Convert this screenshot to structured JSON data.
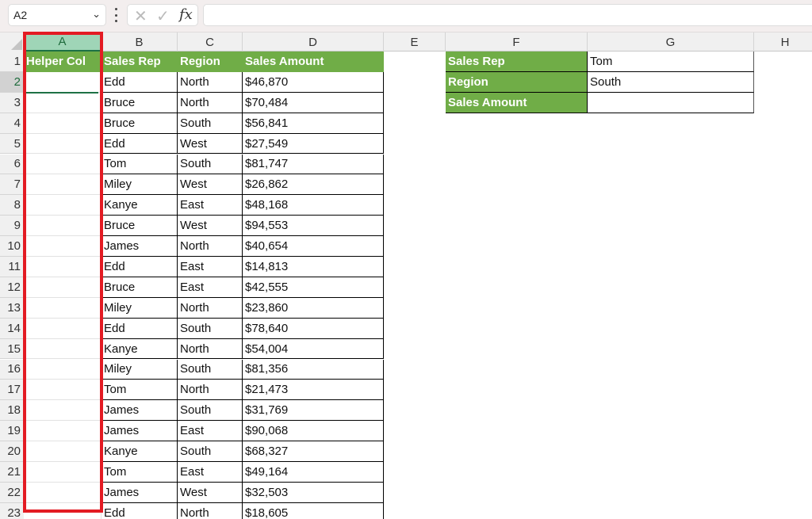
{
  "formula_bar": {
    "name_box": "A2",
    "formula": "",
    "cancel_icon": "close-icon",
    "enter_icon": "check-icon",
    "function_label": "fx"
  },
  "columns": [
    "A",
    "B",
    "C",
    "D",
    "E",
    "F",
    "G",
    "H"
  ],
  "selected_column": "A",
  "rows": [
    "1",
    "2",
    "3",
    "4",
    "5",
    "6",
    "7",
    "8",
    "9",
    "10",
    "11",
    "12",
    "13",
    "14",
    "15",
    "16",
    "17",
    "18",
    "19",
    "20",
    "21",
    "22",
    "23"
  ],
  "selected_row": "2",
  "table": {
    "headers": [
      "Helper Col",
      "Sales Rep",
      "Region",
      "Sales Amount"
    ],
    "data": [
      [
        "",
        "Edd",
        "North",
        "$46,870"
      ],
      [
        "",
        "Bruce",
        "North",
        "$70,484"
      ],
      [
        "",
        "Bruce",
        "South",
        "$56,841"
      ],
      [
        "",
        "Edd",
        "West",
        "$27,549"
      ],
      [
        "",
        "Tom",
        "South",
        "$81,747"
      ],
      [
        "",
        "Miley",
        "West",
        "$26,862"
      ],
      [
        "",
        "Kanye",
        "East",
        "$48,168"
      ],
      [
        "",
        "Bruce",
        "West",
        "$94,553"
      ],
      [
        "",
        "James",
        "North",
        "$40,654"
      ],
      [
        "",
        "Edd",
        "East",
        "$14,813"
      ],
      [
        "",
        "Bruce",
        "East",
        "$42,555"
      ],
      [
        "",
        "Miley",
        "North",
        "$23,860"
      ],
      [
        "",
        "Edd",
        "South",
        "$78,640"
      ],
      [
        "",
        "Kanye",
        "North",
        "$54,004"
      ],
      [
        "",
        "Miley",
        "South",
        "$81,356"
      ],
      [
        "",
        "Tom",
        "North",
        "$21,473"
      ],
      [
        "",
        "James",
        "South",
        "$31,769"
      ],
      [
        "",
        "James",
        "East",
        "$90,068"
      ],
      [
        "",
        "Kanye",
        "South",
        "$68,327"
      ],
      [
        "",
        "Tom",
        "East",
        "$49,164"
      ],
      [
        "",
        "James",
        "West",
        "$32,503"
      ],
      [
        "",
        "Edd",
        "North",
        "$18,605"
      ]
    ]
  },
  "lookup": {
    "rows": [
      {
        "label": "Sales Rep",
        "value": "Tom"
      },
      {
        "label": "Region",
        "value": "South"
      },
      {
        "label": "Sales Amount",
        "value": ""
      }
    ]
  },
  "colors": {
    "header_green": "#70ad47",
    "highlight_red": "#e31b23",
    "selection_green": "#1e7145"
  }
}
